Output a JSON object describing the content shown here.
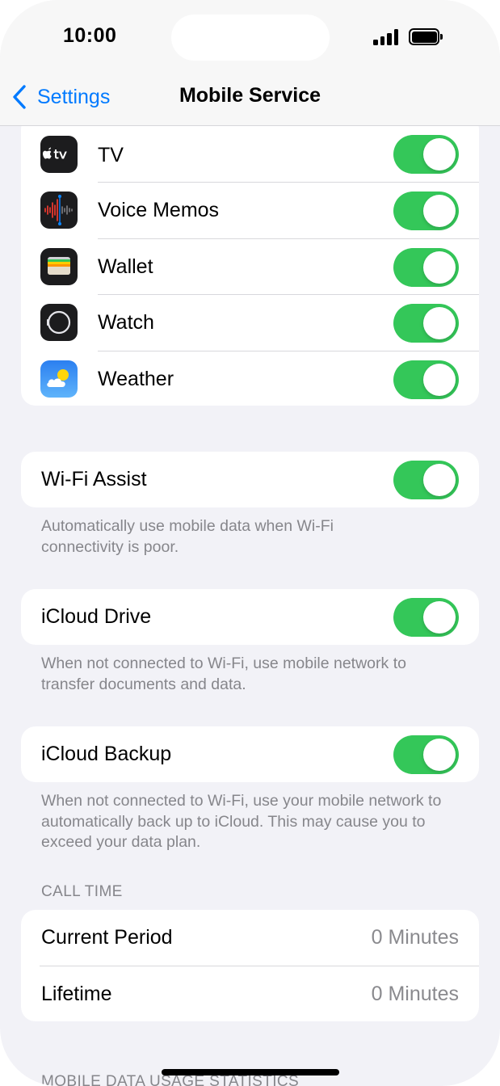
{
  "status": {
    "time": "10:00"
  },
  "nav": {
    "back_label": "Settings",
    "title": "Mobile Service"
  },
  "apps": [
    {
      "label": "TV",
      "icon": "apple-tv-icon",
      "enabled": true
    },
    {
      "label": "Voice Memos",
      "icon": "voice-memos-icon",
      "enabled": true
    },
    {
      "label": "Wallet",
      "icon": "wallet-icon",
      "enabled": true
    },
    {
      "label": "Watch",
      "icon": "watch-icon",
      "enabled": true
    },
    {
      "label": "Weather",
      "icon": "weather-icon",
      "enabled": true
    }
  ],
  "wifi_assist": {
    "label": "Wi-Fi Assist",
    "enabled": true,
    "footer": "Automatically use mobile data when Wi-Fi connectivity is poor."
  },
  "icloud_drive": {
    "label": "iCloud Drive",
    "enabled": true,
    "footer": "When not connected to Wi-Fi, use mobile network to transfer documents and data."
  },
  "icloud_backup": {
    "label": "iCloud Backup",
    "enabled": true,
    "footer": "When not connected to Wi-Fi, use your mobile network to automatically back up to iCloud. This may cause you to exceed your data plan."
  },
  "call_time": {
    "header": "CALL TIME",
    "rows": [
      {
        "label": "Current Period",
        "value": "0 Minutes"
      },
      {
        "label": "Lifetime",
        "value": "0 Minutes"
      }
    ]
  },
  "usage_header": "MOBILE DATA USAGE STATISTICS",
  "colors": {
    "accent": "#007aff",
    "toggle_on": "#34c759",
    "background": "#f2f2f7"
  }
}
